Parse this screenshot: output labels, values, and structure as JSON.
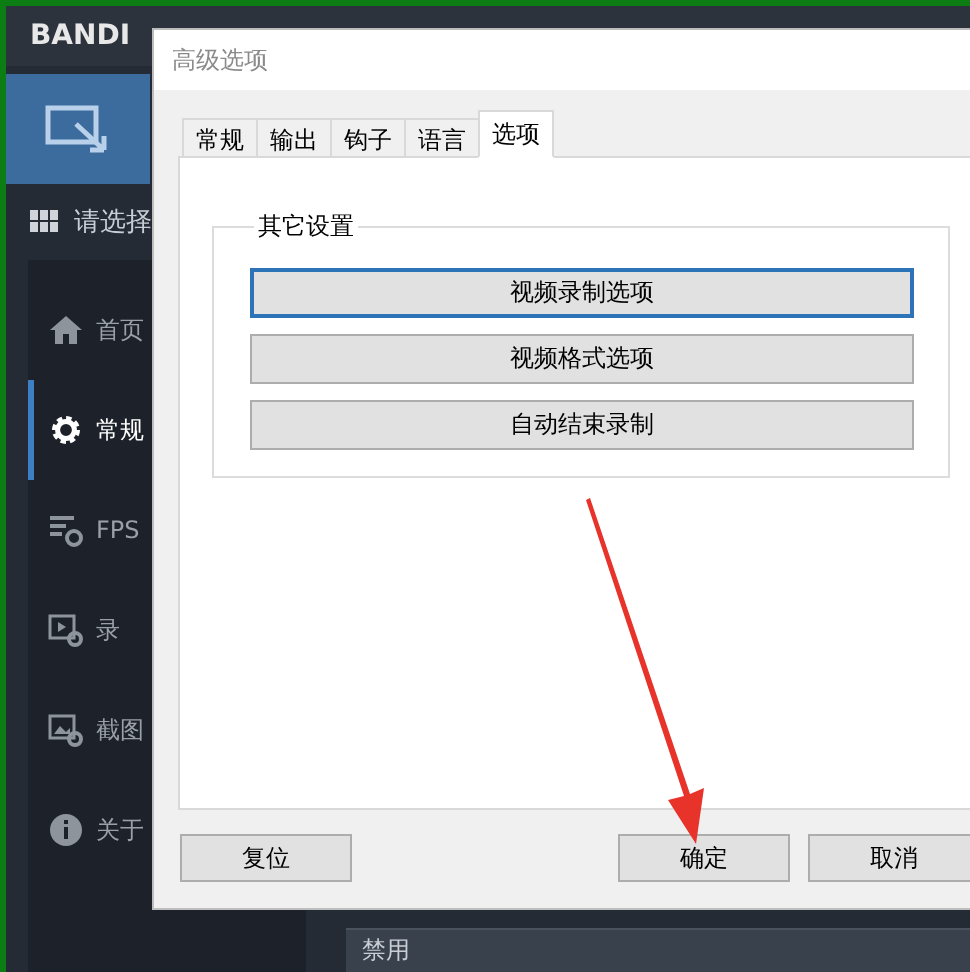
{
  "app": {
    "logo": "BANDI",
    "mode_label": "请选择",
    "nav": [
      {
        "label": "首页",
        "selected": false
      },
      {
        "label": "常规",
        "selected": true
      },
      {
        "label": "FPS",
        "selected": false
      },
      {
        "label": "录",
        "selected": false
      },
      {
        "label": "截图",
        "selected": false
      },
      {
        "label": "关于",
        "selected": false
      }
    ],
    "row_label": "禁用"
  },
  "dialog": {
    "title": "高级选项",
    "tabs": [
      {
        "label": "常规",
        "selected": false
      },
      {
        "label": "输出",
        "selected": false
      },
      {
        "label": "钩子",
        "selected": false
      },
      {
        "label": "语言",
        "selected": false
      },
      {
        "label": "选项",
        "selected": true
      }
    ],
    "group": {
      "title": "其它设置",
      "buttons": [
        {
          "label": "视频录制选项",
          "focused": true
        },
        {
          "label": "视频格式选项",
          "focused": false
        },
        {
          "label": "自动结束录制",
          "focused": false
        }
      ]
    },
    "footer": {
      "reset": "复位",
      "ok": "确定",
      "cancel": "取消"
    }
  }
}
